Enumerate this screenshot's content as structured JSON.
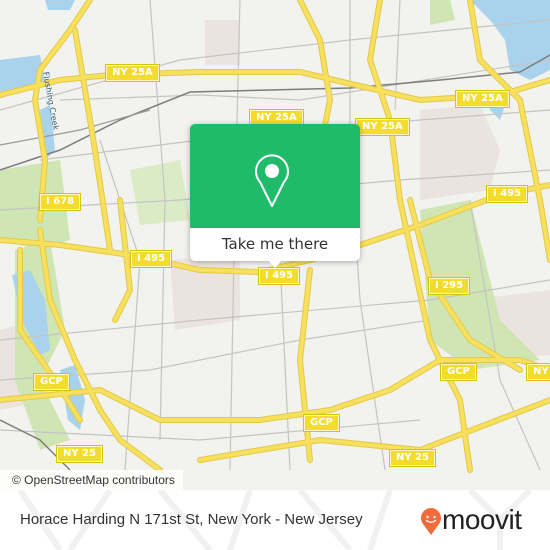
{
  "map": {
    "colors": {
      "land": "#f2f2ef",
      "water": "#a9d2ec",
      "park": "#cfe5b4",
      "urban": "#ebe3df",
      "highway": "#f6e05d",
      "highway_casing": "#e3c94a",
      "street": "#bdbdbd",
      "rail": "#7d7d7d"
    },
    "road_shields": [
      {
        "id": "ny25a-nw",
        "label": "NY 25A"
      },
      {
        "id": "ny25a-center",
        "label": "NY 25A"
      },
      {
        "id": "ny25a-mid",
        "label": "NY 25A"
      },
      {
        "id": "ny25a-ne",
        "label": "NY 25A"
      },
      {
        "id": "i678",
        "label": "I 678"
      },
      {
        "id": "i495-west",
        "label": "I 495"
      },
      {
        "id": "i495-center",
        "label": "I 495"
      },
      {
        "id": "i495-east",
        "label": "I 495"
      },
      {
        "id": "i295",
        "label": "I 295"
      },
      {
        "id": "gcp-west",
        "label": "GCP"
      },
      {
        "id": "gcp-center",
        "label": "GCP"
      },
      {
        "id": "gcp-east",
        "label": "GCP"
      },
      {
        "id": "ny-east",
        "label": "NY"
      },
      {
        "id": "ny25-west",
        "label": "NY 25"
      },
      {
        "id": "ny25-east",
        "label": "NY 25"
      }
    ],
    "water_labels": [
      {
        "id": "flushing-creek",
        "label": "Flushing Creek"
      }
    ],
    "attribution": "© OpenStreetMap contributors"
  },
  "popup": {
    "icon": "location-pin-icon",
    "button_label": "Take me there",
    "color": "#1fba6a"
  },
  "footer": {
    "place_title": "Horace Harding N 171st St, New York - New Jersey",
    "brand": "moovit",
    "brand_color": "#f26b3a"
  }
}
